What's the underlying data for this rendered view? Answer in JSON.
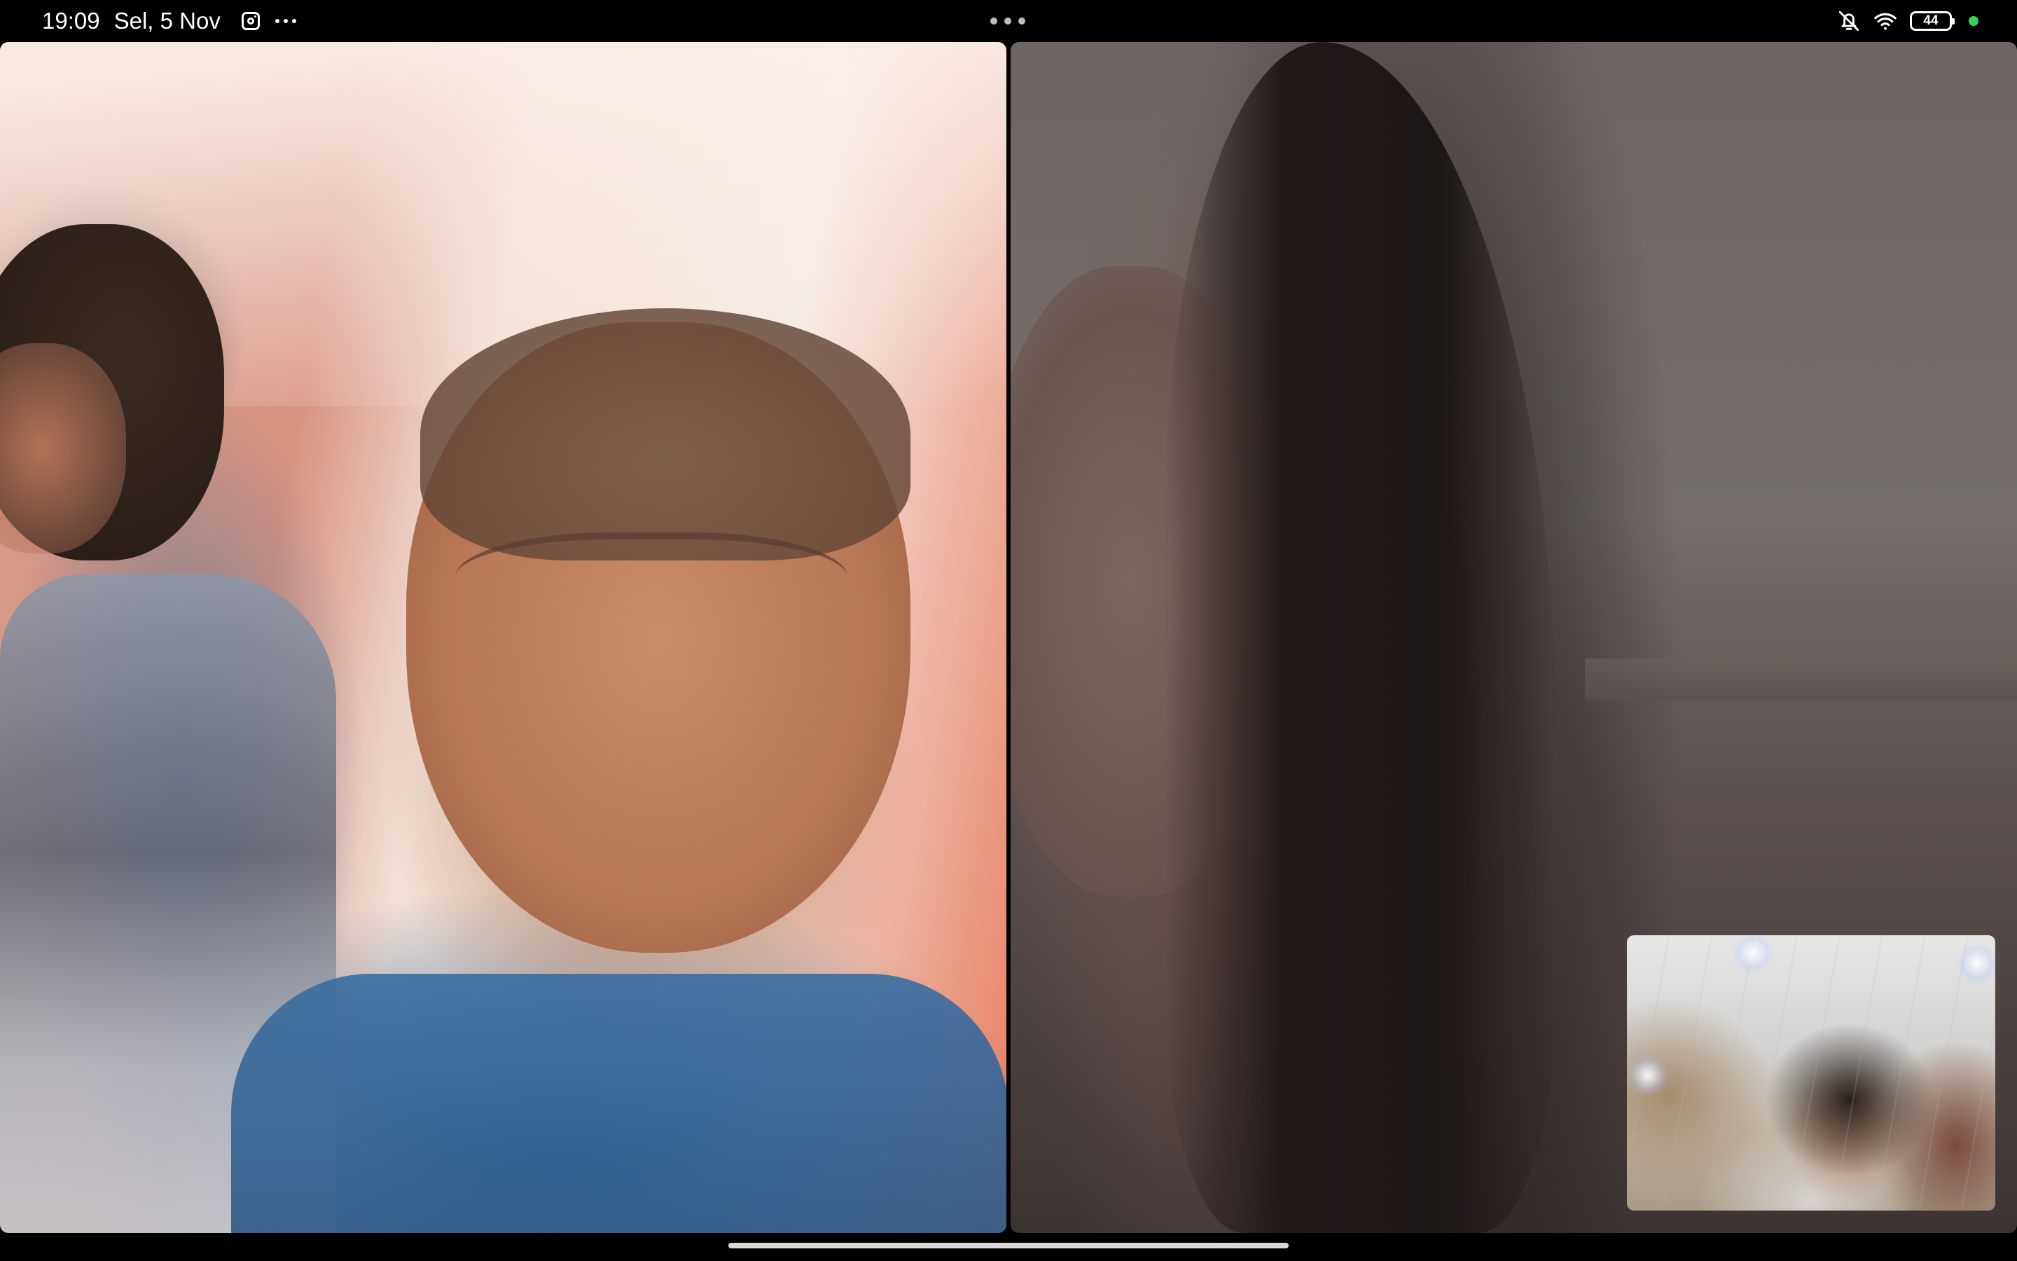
{
  "status_bar": {
    "time": "19:09",
    "date": "Sel, 5 Nov",
    "notification_icons": [
      "instagram-icon",
      "more-icon"
    ],
    "battery_level": "44",
    "system_icons": [
      "bell-off-icon",
      "wifi-icon",
      "battery-icon"
    ],
    "privacy_indicator_color": "#36d35a"
  },
  "video_call": {
    "participants_tiles": 2,
    "self_view": true
  }
}
